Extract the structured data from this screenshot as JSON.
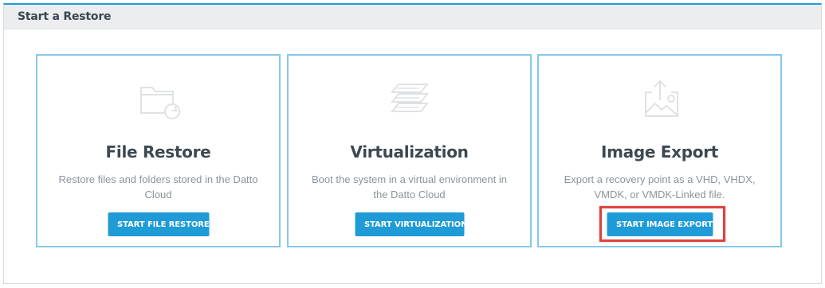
{
  "panel": {
    "title": "Start a Restore"
  },
  "cards": [
    {
      "icon": "folder-restore-icon",
      "title": "File Restore",
      "description": "Restore files and folders stored in the Datto Cloud",
      "button_label": "START FILE RESTORE"
    },
    {
      "icon": "layers-icon",
      "title": "Virtualization",
      "description": "Boot the system in a virtual environment in the Datto Cloud",
      "button_label": "START VIRTUALIZATION"
    },
    {
      "icon": "image-export-icon",
      "title": "Image Export",
      "description": "Export a recovery point as a VHD, VHDX, VMDK, or VMDK-Linked file.",
      "button_label": "START IMAGE EXPORT",
      "highlighted": true
    }
  ],
  "colors": {
    "accent": "#1f9bd7",
    "card_border": "#86c8ea",
    "highlight": "#e0413f"
  }
}
